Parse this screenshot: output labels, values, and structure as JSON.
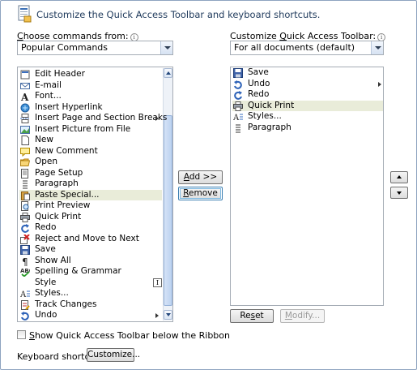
{
  "header": {
    "text": "Customize the Quick Access Toolbar and keyboard shortcuts.",
    "icon": "customize-toolbar-icon"
  },
  "left": {
    "label_pre": "",
    "label_hot": "C",
    "label_post": "hoose commands from:",
    "combo_value": "Popular Commands",
    "items": [
      {
        "label": "Edit Header",
        "icon": "edit-header-icon"
      },
      {
        "label": "E-mail",
        "icon": "email-icon"
      },
      {
        "label": "Font...",
        "icon": "font-icon"
      },
      {
        "label": "Insert Hyperlink",
        "icon": "hyperlink-icon"
      },
      {
        "label": "Insert Page and Section Breaks",
        "icon": "page-break-icon",
        "submenu": true
      },
      {
        "label": "Insert Picture from File",
        "icon": "picture-icon"
      },
      {
        "label": "New",
        "icon": "new-doc-icon"
      },
      {
        "label": "New Comment",
        "icon": "comment-icon"
      },
      {
        "label": "Open",
        "icon": "open-folder-icon"
      },
      {
        "label": "Page Setup",
        "icon": "page-setup-icon"
      },
      {
        "label": "Paragraph",
        "icon": "paragraph-icon"
      },
      {
        "label": "Paste Special...",
        "icon": "paste-icon",
        "selected": true
      },
      {
        "label": "Print Preview",
        "icon": "print-preview-icon"
      },
      {
        "label": "Quick Print",
        "icon": "printer-icon"
      },
      {
        "label": "Redo",
        "icon": "redo-icon"
      },
      {
        "label": "Reject and Move to Next",
        "icon": "reject-icon"
      },
      {
        "label": "Save",
        "icon": "save-icon"
      },
      {
        "label": "Show All",
        "icon": "pilcrow-icon"
      },
      {
        "label": "Spelling & Grammar",
        "icon": "spelling-icon"
      },
      {
        "label": "Style",
        "icon": "style-icon",
        "style_box": true
      },
      {
        "label": "Styles...",
        "icon": "styles-icon"
      },
      {
        "label": "Track Changes",
        "icon": "track-changes-icon"
      },
      {
        "label": "Undo",
        "icon": "undo-icon",
        "submenu": true
      }
    ]
  },
  "right": {
    "label_pre": "Customize ",
    "label_hot": "Q",
    "label_post": "uick Access Toolbar:",
    "combo_value": "For all documents (default)",
    "items": [
      {
        "label": "Save",
        "icon": "save-icon"
      },
      {
        "label": "Undo",
        "icon": "undo-icon",
        "submenu": true
      },
      {
        "label": "Redo",
        "icon": "redo-icon"
      },
      {
        "label": "Quick Print",
        "icon": "printer-icon",
        "selected": true
      },
      {
        "label": "Styles...",
        "icon": "styles-icon"
      },
      {
        "label": "Paragraph",
        "icon": "paragraph-icon"
      }
    ]
  },
  "buttons": {
    "add_hot": "A",
    "add_rest": "dd >>",
    "remove_hot": "R",
    "remove_rest": "emove",
    "reset_pre": "Re",
    "reset_hot": "s",
    "reset_post": "et",
    "modify_hot": "M",
    "modify_rest": "odify...",
    "customize_label": "Customize..."
  },
  "footer": {
    "checkbox_hot": "S",
    "checkbox_rest": "how Quick Access Toolbar below the Ribbon",
    "shortcuts_label": "Keyboard shortcuts:"
  },
  "colors": {
    "selected_row": "#e9ecd9",
    "header_text": "#1e395b",
    "border": "#8ea3c0"
  }
}
